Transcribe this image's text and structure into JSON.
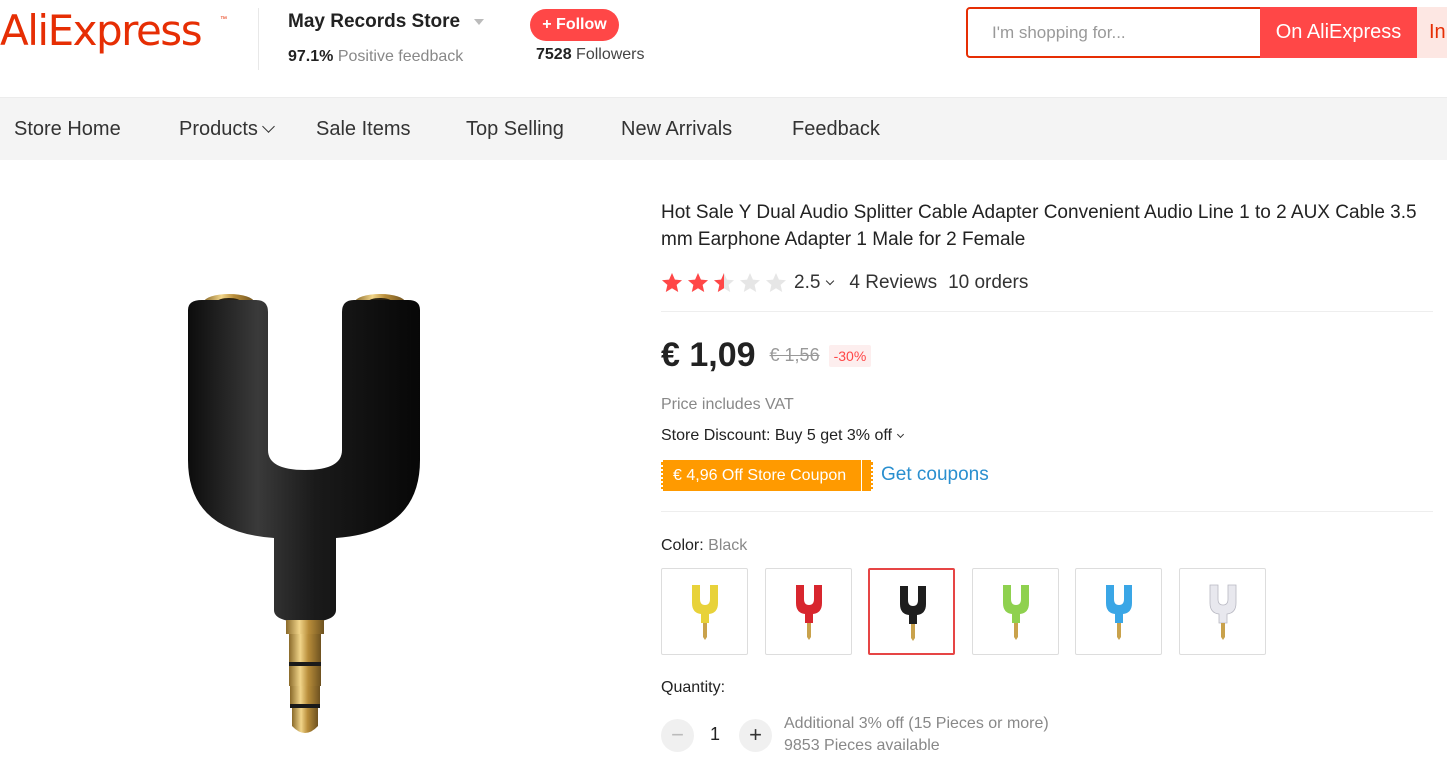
{
  "header": {
    "logo_text": "AliExpress",
    "logo_tm": "™",
    "store_name": "May Records Store",
    "feedback_percent": "97.1%",
    "feedback_label": "Positive feedback",
    "follow_label": "+ Follow",
    "followers_count": "7528",
    "followers_label": "Followers",
    "search_placeholder": "I'm shopping for...",
    "search_on_aliexpress": "On AliExpress",
    "search_in_store": "In"
  },
  "nav": {
    "items": [
      {
        "label": "Store Home"
      },
      {
        "label": "Products"
      },
      {
        "label": "Sale Items"
      },
      {
        "label": "Top Selling"
      },
      {
        "label": "New Arrivals"
      },
      {
        "label": "Feedback"
      }
    ]
  },
  "product": {
    "title": "Hot Sale Y Dual Audio Splitter Cable Adapter Convenient Audio Line 1 to 2 AUX Cable 3.5 mm Earphone Adapter 1 Male for 2 Female",
    "rating_value": "2.5",
    "rating_stars": 2.5,
    "reviews": "4 Reviews",
    "orders": "10 orders",
    "price": "€ 1,09",
    "old_price": "€ 1,56",
    "discount": "-30%",
    "vat_note": "Price includes VAT",
    "store_discount": "Store Discount: Buy 5 get 3% off",
    "coupon": "€ 4,96 Off Store Coupon",
    "get_coupons": "Get coupons",
    "color_label": "Color:",
    "color_selected": "Black",
    "colors": [
      {
        "name": "yellow",
        "hex": "#e8d23a"
      },
      {
        "name": "red",
        "hex": "#d8262e"
      },
      {
        "name": "black",
        "hex": "#1e1e1e"
      },
      {
        "name": "green",
        "hex": "#8fd14f"
      },
      {
        "name": "blue",
        "hex": "#3aa6e6"
      },
      {
        "name": "white",
        "hex": "#e8e8ee"
      }
    ],
    "quantity_label": "Quantity:",
    "quantity_value": "1",
    "quantity_minus": "−",
    "quantity_plus": "+",
    "bulk_note": "Additional 3% off (15 Pieces or more)",
    "stock_note": "9853 Pieces available"
  },
  "colors": {
    "brand": "#e62e04",
    "accent": "#ff4747",
    "coupon": "#ff9a00",
    "link": "#2a8fcf",
    "star": "#ff4747"
  }
}
